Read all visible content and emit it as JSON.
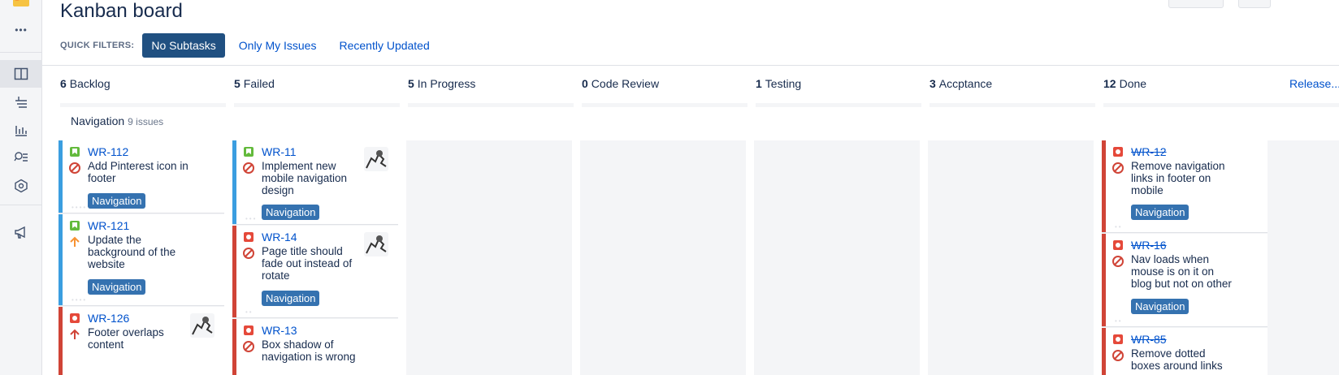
{
  "sidebar": {
    "items": [
      {
        "name": "project-avatar-icon"
      },
      {
        "name": "more-icon",
        "glyph": "•••"
      },
      {
        "name": "board-icon"
      },
      {
        "name": "backlog-icon"
      },
      {
        "name": "reports-icon"
      },
      {
        "name": "issues-search-icon"
      },
      {
        "name": "components-icon"
      },
      {
        "name": "feedback-icon"
      }
    ]
  },
  "header": {
    "title": "Kanban board"
  },
  "quick_filters": {
    "label": "QUICK FILTERS:",
    "filters": [
      {
        "label": "No Subtasks",
        "active": true
      },
      {
        "label": "Only My Issues",
        "active": false
      },
      {
        "label": "Recently Updated",
        "active": false
      }
    ]
  },
  "columns": [
    {
      "count": "6",
      "name": "Backlog"
    },
    {
      "count": "5",
      "name": "Failed"
    },
    {
      "count": "5",
      "name": "In Progress"
    },
    {
      "count": "0",
      "name": "Code Review"
    },
    {
      "count": "1",
      "name": "Testing"
    },
    {
      "count": "3",
      "name": "Accptance"
    },
    {
      "count": "12",
      "name": "Done",
      "action": "Release..."
    }
  ],
  "swimlane": {
    "name": "Navigation",
    "count": "9 issues"
  },
  "cards": {
    "backlog": [
      {
        "key": "WR-112",
        "summary": "Add Pinterest icon in footer",
        "epic": "Navigation",
        "type": "story",
        "priority": "blocker",
        "color": "#3b9ee0"
      },
      {
        "key": "WR-121",
        "summary": "Update the background of the website",
        "epic": "Navigation",
        "type": "story",
        "priority": "major",
        "color": "#3b9ee0"
      },
      {
        "key": "WR-126",
        "summary": "Footer overlaps content",
        "type": "bug",
        "priority": "critical",
        "color": "#d04437"
      }
    ],
    "failed": [
      {
        "key": "WR-11",
        "summary": "Implement new mobile navigation design",
        "epic": "Navigation",
        "type": "story",
        "priority": "blocker",
        "color": "#3b9ee0"
      },
      {
        "key": "WR-14",
        "summary": "Page title should fade out instead of rotate",
        "epic": "Navigation",
        "type": "bug",
        "priority": "blocker",
        "color": "#d04437"
      },
      {
        "key": "WR-13",
        "summary": "Box shadow of navigation is wrong",
        "type": "bug",
        "priority": "blocker",
        "color": "#d04437"
      }
    ],
    "done": [
      {
        "key": "WR-12",
        "summary": "Remove navigation links in footer on mobile",
        "epic": "Navigation",
        "type": "bug",
        "priority": "blocker",
        "color": "#d04437"
      },
      {
        "key": "WR-16",
        "summary": "Nav loads when mouse is on it on blog but not on other",
        "epic": "Navigation",
        "type": "bug",
        "priority": "blocker",
        "color": "#d04437"
      },
      {
        "key": "WR-85",
        "summary": "Remove dotted boxes around links",
        "type": "bug",
        "priority": "blocker",
        "color": "#d04437"
      }
    ]
  },
  "colors": {
    "accent": "#205081",
    "link": "#0052cc",
    "epic": "#3572b0",
    "story": "#63ba3c",
    "bug": "#e5493a"
  }
}
